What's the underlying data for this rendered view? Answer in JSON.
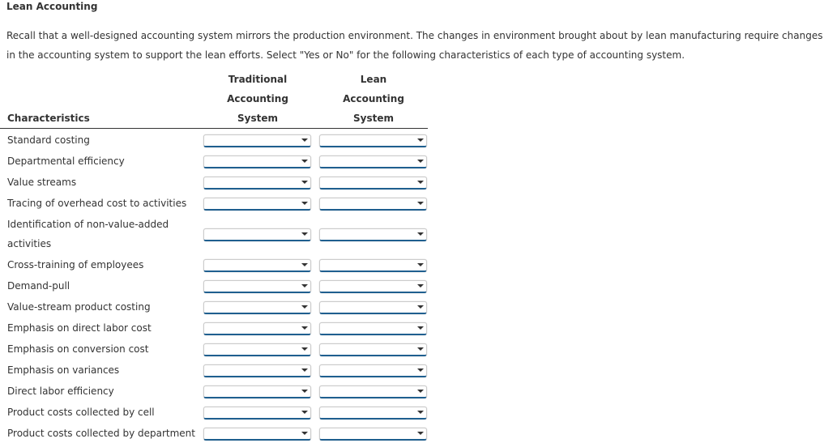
{
  "title": "Lean Accounting",
  "instructions": [
    "Recall that a well-designed accounting system mirrors the production environment. The changes in environment brought about by lean manufacturing require changes",
    "in the accounting system to support the lean efforts. Select \"Yes or No\" for the following characteristics of each type of accounting system."
  ],
  "table": {
    "col_characteristics": "Characteristics",
    "col_traditional": [
      "Traditional",
      "Accounting",
      "System"
    ],
    "col_lean": [
      "Lean",
      "Accounting",
      "System"
    ],
    "rows": [
      {
        "label": [
          "Standard costing"
        ],
        "traditional": "",
        "lean": ""
      },
      {
        "label": [
          "Departmental efficiency"
        ],
        "traditional": "",
        "lean": ""
      },
      {
        "label": [
          "Value streams"
        ],
        "traditional": "",
        "lean": ""
      },
      {
        "label": [
          "Tracing of overhead cost to activities"
        ],
        "traditional": "",
        "lean": ""
      },
      {
        "label": [
          "Identification of non-value-added",
          "activities"
        ],
        "traditional": "",
        "lean": ""
      },
      {
        "label": [
          "Cross-training of employees"
        ],
        "traditional": "",
        "lean": ""
      },
      {
        "label": [
          "Demand-pull"
        ],
        "traditional": "",
        "lean": ""
      },
      {
        "label": [
          "Value-stream product costing"
        ],
        "traditional": "",
        "lean": ""
      },
      {
        "label": [
          "Emphasis on direct labor cost"
        ],
        "traditional": "",
        "lean": ""
      },
      {
        "label": [
          "Emphasis on conversion cost"
        ],
        "traditional": "",
        "lean": ""
      },
      {
        "label": [
          "Emphasis on variances"
        ],
        "traditional": "",
        "lean": ""
      },
      {
        "label": [
          "Direct labor efficiency"
        ],
        "traditional": "",
        "lean": ""
      },
      {
        "label": [
          "Product costs collected by cell"
        ],
        "traditional": "",
        "lean": ""
      },
      {
        "label": [
          "Product costs collected by department"
        ],
        "traditional": "",
        "lean": ""
      }
    ]
  },
  "colors": {
    "dropdown_underline": "#1f5f8f",
    "text": "#333333"
  }
}
